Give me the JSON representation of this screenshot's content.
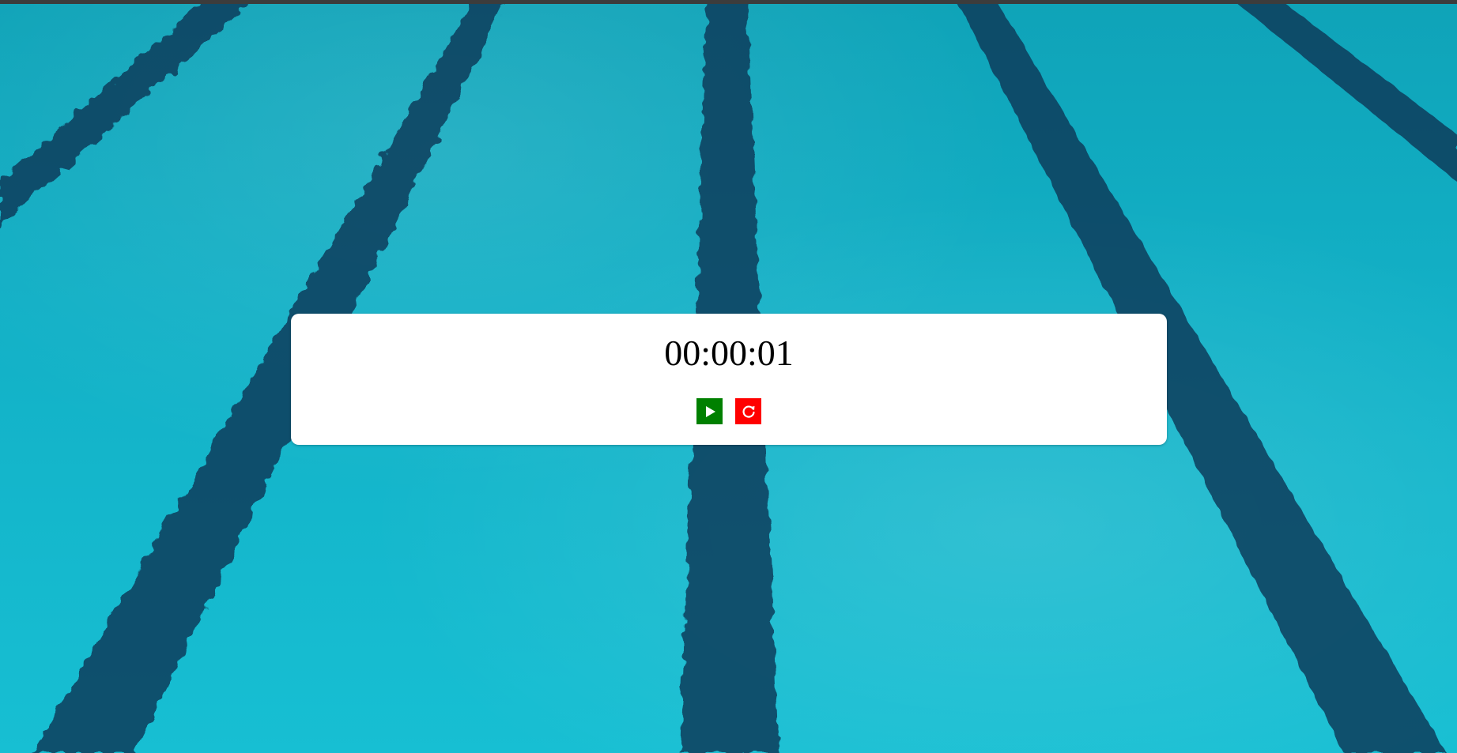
{
  "stopwatch": {
    "time": "00:00:01"
  },
  "controls": {
    "play": {
      "icon": "play-icon",
      "color": "#008000"
    },
    "reset": {
      "icon": "refresh-icon",
      "color": "#ff0000"
    }
  },
  "background": {
    "description_icon": "swimming-pool-background",
    "water_color": "#12b0c6",
    "lane_color": "#0b3d5c"
  }
}
